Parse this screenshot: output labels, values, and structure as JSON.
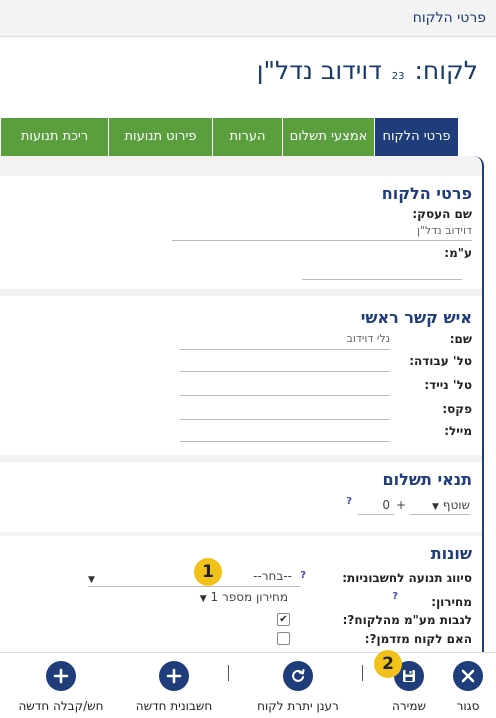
{
  "window": {
    "title": "פרטי הלקוח"
  },
  "customer": {
    "prefix": "לקוח:",
    "number": "23",
    "name": "דוידוב נדל\"ן"
  },
  "tabs": [
    "פרטי הלקוח",
    "אמצעי תשלום",
    "הערות",
    "פירוט תנועות",
    "ריכת תנועות"
  ],
  "customer_details": {
    "title": "פרטי הלקוח",
    "business_name_label": "שם העסק:",
    "business_name_value": "דוידוב נדל\"ן",
    "vat_label": "ע\"מ:",
    "vat_value": ""
  },
  "main_contact": {
    "title": "איש קשר ראשי",
    "name_label": "שם:",
    "name_value": "נלי דוידוב",
    "work_phone_label": "טל' עבודה:",
    "mobile_label": "טל' נייד:",
    "fax_label": "פקס:",
    "email_label": "מייל:"
  },
  "payment_terms": {
    "title": "תנאי תשלום",
    "term_option": "שוטף",
    "plus": "+",
    "days": "0",
    "help": "?"
  },
  "misc": {
    "title": "שונות",
    "invoice_class_label": "סיווג תנועה לחשבוניות:",
    "invoice_class_value": "--בחר--",
    "price_list_label": "מחירון:",
    "price_list_value": "מחירון מספר 1",
    "collect_vat_label": "לגבות מע\"מ מהלקוח?:",
    "occasional_label": "האם לקוח מזדמן?:",
    "collect_vat_checked": true,
    "occasional_checked": false,
    "help": "?"
  },
  "badges": {
    "one": "1",
    "two": "2"
  },
  "toolbar": {
    "close": "סגור",
    "save": "שמירה",
    "refresh": "רענן יתרת לקוח",
    "new_invoice": "חשבונית חדשה",
    "new_receipt": "חש/קבלה חדשה"
  },
  "colors": {
    "navy": "#1f3c7b",
    "green": "#5a9e3e",
    "badge": "#f2c21b"
  }
}
